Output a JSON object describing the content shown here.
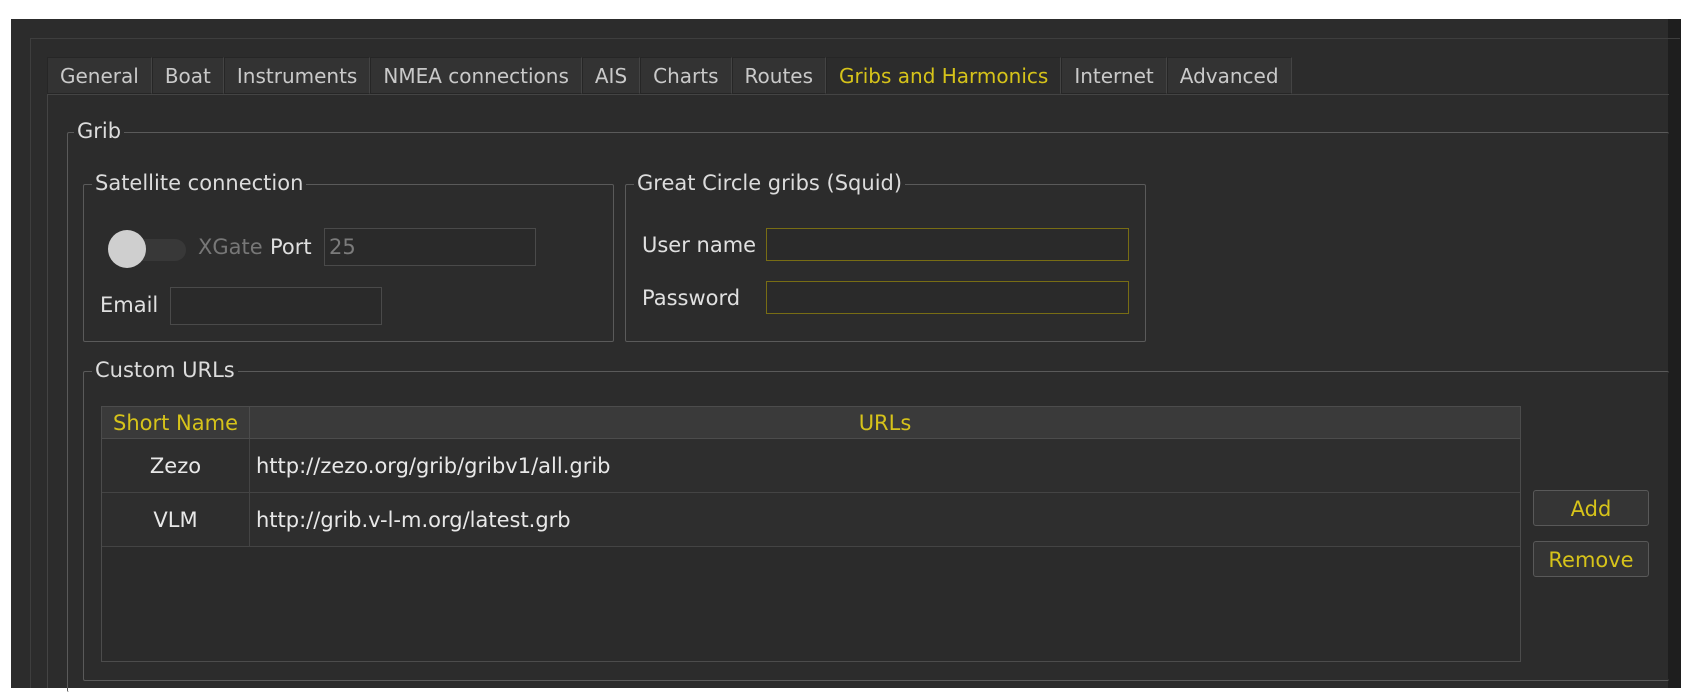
{
  "tabs": [
    {
      "label": "General"
    },
    {
      "label": "Boat"
    },
    {
      "label": "Instruments"
    },
    {
      "label": "NMEA connections"
    },
    {
      "label": "AIS"
    },
    {
      "label": "Charts"
    },
    {
      "label": "Routes"
    },
    {
      "label": "Gribs and Harmonics",
      "active": true
    },
    {
      "label": "Internet"
    },
    {
      "label": "Advanced"
    }
  ],
  "grib": {
    "title": "Grib",
    "satellite": {
      "title": "Satellite connection",
      "toggle_label": "XGate",
      "toggle_on": false,
      "port_label": "Port",
      "port_value": "25",
      "email_label": "Email",
      "email_value": ""
    },
    "squid": {
      "title": "Great Circle gribs (Squid)",
      "username_label": "User name",
      "username_value": "",
      "password_label": "Password",
      "password_value": ""
    },
    "custom_urls": {
      "title": "Custom URLs",
      "columns": [
        "Short Name",
        "URLs"
      ],
      "rows": [
        {
          "name": "Zezo",
          "url": "http://zezo.org/grib/gribv1/all.grib"
        },
        {
          "name": "VLM",
          "url": "http://grib.v-l-m.org/latest.grb"
        }
      ],
      "add_label": "Add",
      "remove_label": "Remove"
    }
  },
  "colors": {
    "accent": "#d6c31a",
    "background": "#2c2c2c",
    "text": "#e0e0e0"
  }
}
